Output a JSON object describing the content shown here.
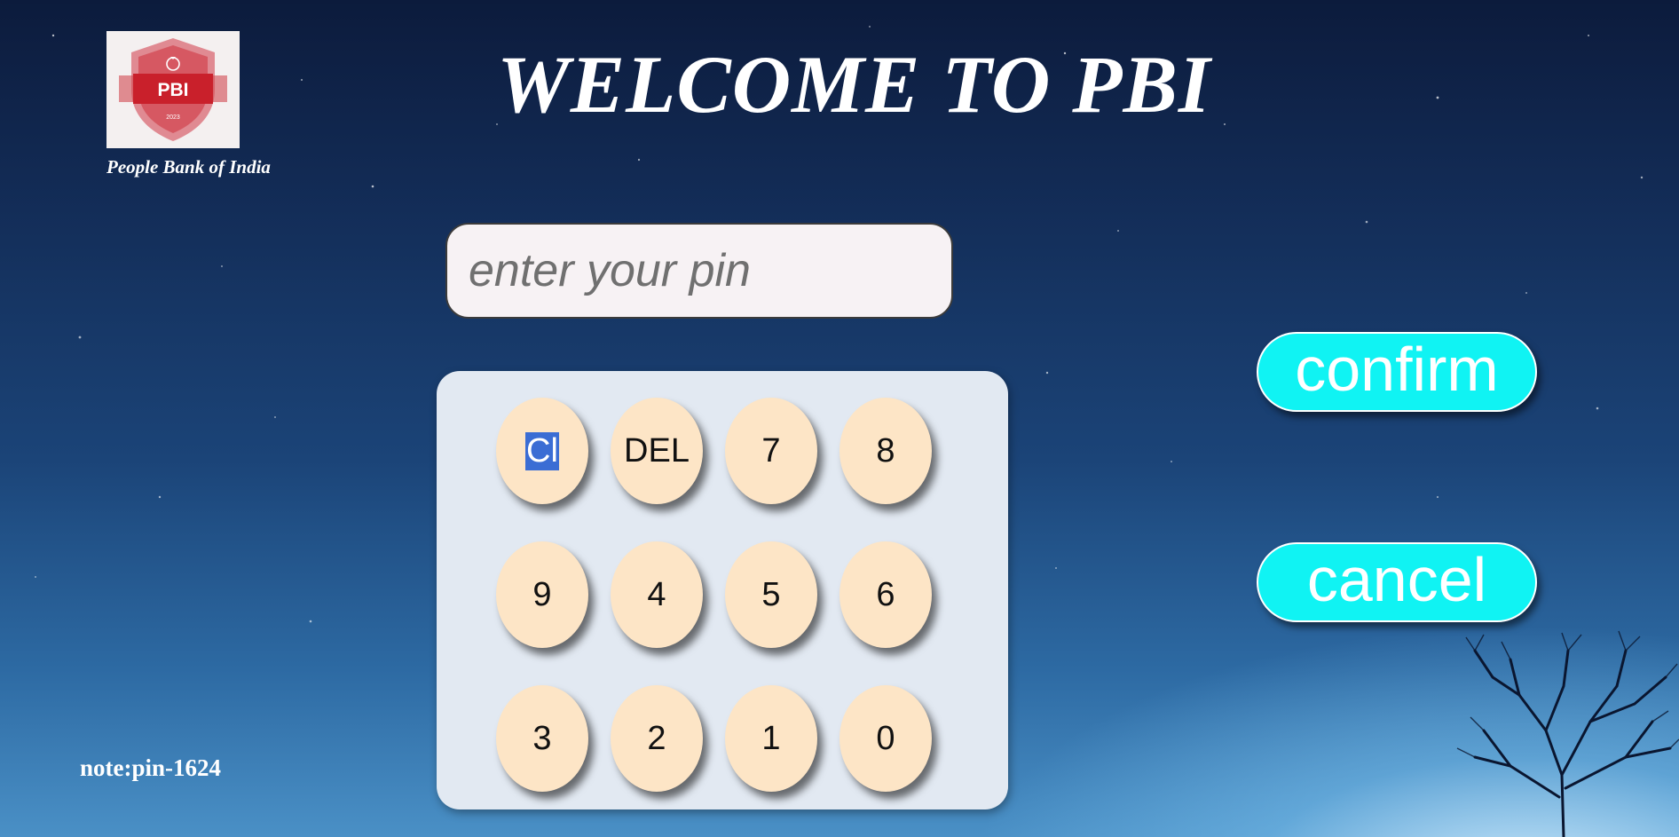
{
  "brand": {
    "logo_text": "PBI",
    "logo_year": "2023",
    "name": "People Bank of India"
  },
  "header": {
    "title": "WELCOME TO PBI"
  },
  "pin_field": {
    "value": "",
    "placeholder": "enter your pin"
  },
  "keypad": {
    "keys": [
      {
        "label": "Cl"
      },
      {
        "label": "DEL"
      },
      {
        "label": "7"
      },
      {
        "label": "8"
      },
      {
        "label": "9"
      },
      {
        "label": "4"
      },
      {
        "label": "5"
      },
      {
        "label": "6"
      },
      {
        "label": "3"
      },
      {
        "label": "2"
      },
      {
        "label": "1"
      },
      {
        "label": "0"
      }
    ]
  },
  "actions": {
    "confirm_label": "confirm",
    "cancel_label": "cancel"
  },
  "note": "note:pin-1624",
  "colors": {
    "action_button": "#10f3f3",
    "key_fill": "#fde5c6",
    "keypad_panel": "#e2e9f2",
    "logo_red": "#c9202b",
    "selection": "#3b6dd4"
  },
  "icons": {
    "logo_emblem": "money-bag-icon",
    "decor": "tree-silhouette"
  }
}
